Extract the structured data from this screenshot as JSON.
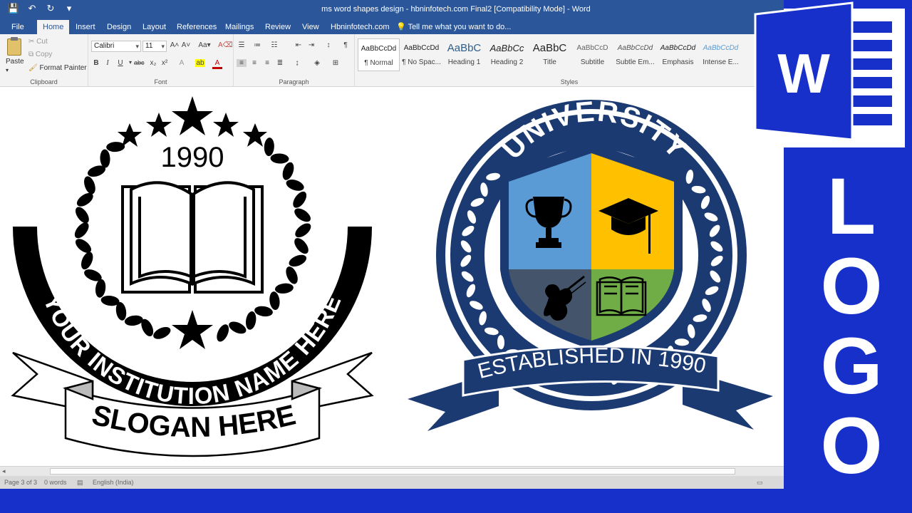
{
  "window": {
    "title": "ms word shapes design - hbninfotech.com Final2 [Compatibility Mode] - Word"
  },
  "quick_access": {
    "save_icon": "save-icon",
    "undo_icon": "undo-icon",
    "redo_icon": "redo-icon"
  },
  "tabs": [
    {
      "label": "File"
    },
    {
      "label": "Home"
    },
    {
      "label": "Insert"
    },
    {
      "label": "Design"
    },
    {
      "label": "Layout"
    },
    {
      "label": "References"
    },
    {
      "label": "Mailings"
    },
    {
      "label": "Review"
    },
    {
      "label": "View"
    },
    {
      "label": "Hbninfotech.com"
    }
  ],
  "tell_me": "Tell me what you want to do...",
  "ribbon": {
    "clipboard": {
      "paste": "Paste",
      "cut": "Cut",
      "copy": "Copy",
      "format_painter": "Format Painter",
      "label": "Clipboard"
    },
    "font": {
      "family": "Calibri",
      "size": "11",
      "label": "Font"
    },
    "paragraph": {
      "label": "Paragraph"
    },
    "styles": {
      "label": "Styles",
      "items": [
        {
          "sample": "AaBbCcDd",
          "name": "¶ Normal"
        },
        {
          "sample": "AaBbCcDd",
          "name": "¶ No Spac..."
        },
        {
          "sample": "AaBbC",
          "name": "Heading 1"
        },
        {
          "sample": "AaBbCc",
          "name": "Heading 2"
        },
        {
          "sample": "AaBbC",
          "name": "Title"
        },
        {
          "sample": "AaBbCcD",
          "name": "Subtitle"
        },
        {
          "sample": "AaBbCcDd",
          "name": "Subtle Em..."
        },
        {
          "sample": "AaBbCcDd",
          "name": "Emphasis"
        },
        {
          "sample": "AaBbCcDd",
          "name": "Intense E..."
        }
      ]
    }
  },
  "document": {
    "logo1": {
      "year": "1990",
      "arc_text": "YOUR INSTITUTION NAME HERE",
      "slogan": "SLOGAN HERE"
    },
    "logo2": {
      "arc_text": "UNIVERSITY",
      "ribbon_text": "ESTABLISHED IN 1990"
    }
  },
  "status": {
    "page": "Page 3 of 3",
    "words": "0 words",
    "language": "English (India)"
  },
  "branding": {
    "word_letter": "W",
    "logo_text": "LOGO"
  },
  "colors": {
    "word_blue": "#2b579a",
    "brand_blue": "#1730c9",
    "navy": "#1c3a72",
    "shield_blue": "#5b9bd5",
    "shield_yellow": "#ffc000",
    "shield_slate": "#44546a",
    "shield_green": "#70ad47"
  }
}
